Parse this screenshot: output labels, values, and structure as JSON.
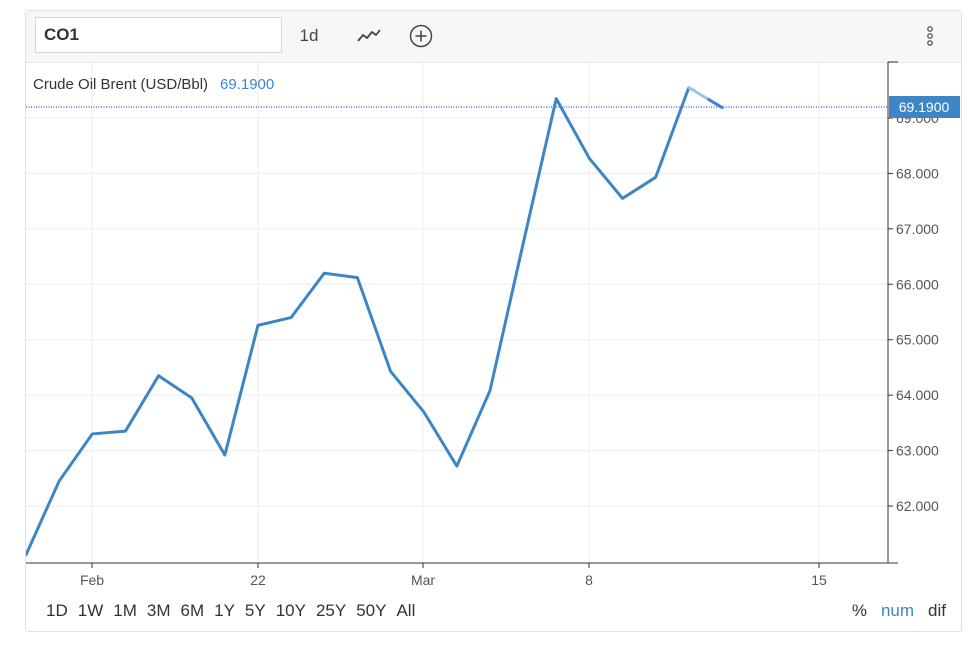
{
  "toolbar": {
    "symbol_value": "CO1",
    "interval_label": "1d",
    "chart_type_icon": "line-chart-icon",
    "compare_icon": "plus-circle-icon",
    "menu_icon": "vertical-dots-icon"
  },
  "legend": {
    "name": "Crude Oil Brent (USD/Bbl)",
    "value": "69.1900"
  },
  "price_tag": "69.1900",
  "colors": {
    "line": "#3d86c6",
    "line_last": "#9cc3e6",
    "price_tag_bg": "#3d86c6",
    "grid": "#ececec",
    "price_line": "#2f57d6"
  },
  "chart_data": {
    "type": "line",
    "title": "",
    "xlabel": "",
    "ylabel": "",
    "x_ticks": [
      "Feb",
      "22",
      "Mar",
      "8",
      "15"
    ],
    "y_ticks": [
      "62.000",
      "63.000",
      "64.000",
      "65.000",
      "66.000",
      "67.000",
      "68.000",
      "69.000"
    ],
    "ylim": [
      61.0,
      70.0
    ],
    "grid": true,
    "series": [
      {
        "values": [
          61.12,
          62.45,
          63.3,
          63.35,
          64.35,
          63.95,
          62.92,
          65.26,
          65.4,
          66.2,
          66.12,
          64.43,
          63.7,
          62.72,
          64.08,
          66.73,
          69.35,
          68.27,
          67.55,
          67.93,
          69.55,
          69.19
        ]
      }
    ]
  },
  "range_buttons": [
    "1D",
    "1W",
    "1M",
    "3M",
    "6M",
    "1Y",
    "5Y",
    "10Y",
    "25Y",
    "50Y",
    "All"
  ],
  "mode_buttons": [
    "%",
    "num",
    "dif"
  ],
  "active_mode": "num"
}
